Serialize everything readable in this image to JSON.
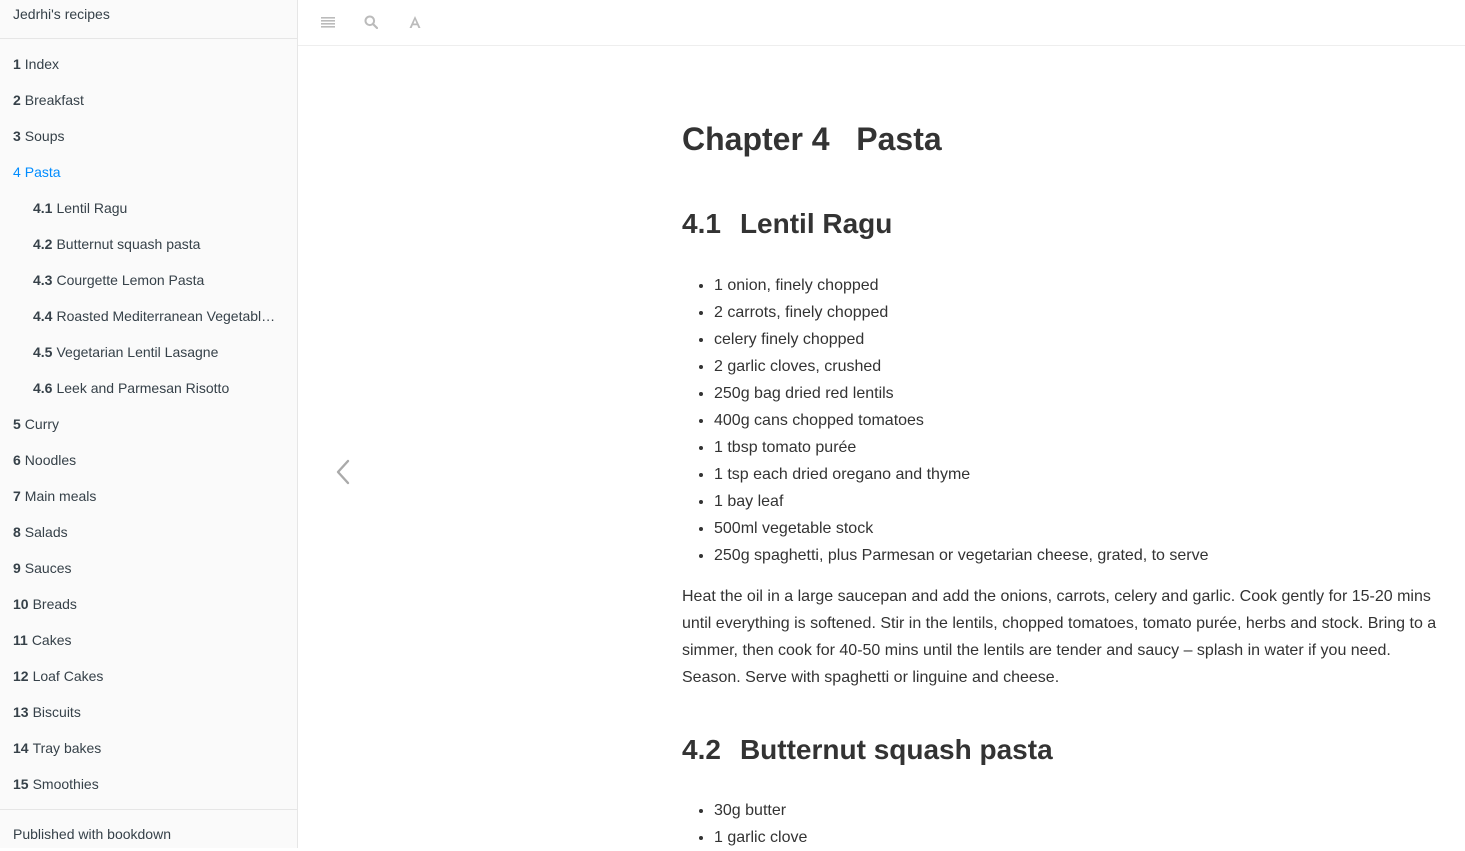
{
  "sidebar": {
    "site_title": "Jedrhi's recipes",
    "items": [
      {
        "num": "1",
        "label": "Index"
      },
      {
        "num": "2",
        "label": "Breakfast"
      },
      {
        "num": "3",
        "label": "Soups"
      },
      {
        "num": "4",
        "label": "Pasta"
      },
      {
        "num": "4.1",
        "label": "Lentil Ragu"
      },
      {
        "num": "4.2",
        "label": "Butternut squash pasta"
      },
      {
        "num": "4.3",
        "label": "Courgette Lemon Pasta"
      },
      {
        "num": "4.4",
        "label": "Roasted Mediterranean Vegetable Pasta"
      },
      {
        "num": "4.5",
        "label": "Vegetarian Lentil Lasagne"
      },
      {
        "num": "4.6",
        "label": "Leek and Parmesan Risotto"
      },
      {
        "num": "5",
        "label": "Curry"
      },
      {
        "num": "6",
        "label": "Noodles"
      },
      {
        "num": "7",
        "label": "Main meals"
      },
      {
        "num": "8",
        "label": "Salads"
      },
      {
        "num": "9",
        "label": "Sauces"
      },
      {
        "num": "10",
        "label": "Breads"
      },
      {
        "num": "11",
        "label": "Cakes"
      },
      {
        "num": "12",
        "label": "Loaf Cakes"
      },
      {
        "num": "13",
        "label": "Biscuits"
      },
      {
        "num": "14",
        "label": "Tray bakes"
      },
      {
        "num": "15",
        "label": "Smoothies"
      }
    ],
    "published": "Published with bookdown"
  },
  "toolbar": {
    "icons": [
      "toc-toggle-icon",
      "search-icon",
      "font-settings-icon"
    ]
  },
  "content": {
    "chapter_title": "Chapter 4   Pasta",
    "sections": [
      {
        "num": "4.1",
        "title": "Lentil Ragu",
        "ingredients": [
          "1 onion, finely chopped",
          "2 carrots, finely chopped",
          "celery finely chopped",
          "2 garlic cloves, crushed",
          "250g bag dried red lentils",
          "400g cans chopped tomatoes",
          "1 tbsp tomato purée",
          "1 tsp each dried oregano and thyme",
          "1 bay leaf",
          "500ml vegetable stock",
          "250g spaghetti, plus Parmesan or vegetarian cheese, grated, to serve"
        ],
        "method": "Heat the oil in a large saucepan and add the onions, carrots, celery and garlic. Cook gently for 15-20 mins until everything is softened. Stir in the lentils, chopped tomatoes, tomato purée, herbs and stock. Bring to a simmer, then cook for 40-50 mins until the lentils are tender and saucy – splash in water if you need. Season. Serve with spaghetti or linguine and cheese."
      },
      {
        "num": "4.2",
        "title": "Butternut squash pasta",
        "ingredients": [
          "30g butter",
          "1 garlic clove"
        ]
      }
    ]
  },
  "colors": {
    "active_link": "#008cff",
    "text": "#333333",
    "sidebar_bg": "#fafafa"
  }
}
